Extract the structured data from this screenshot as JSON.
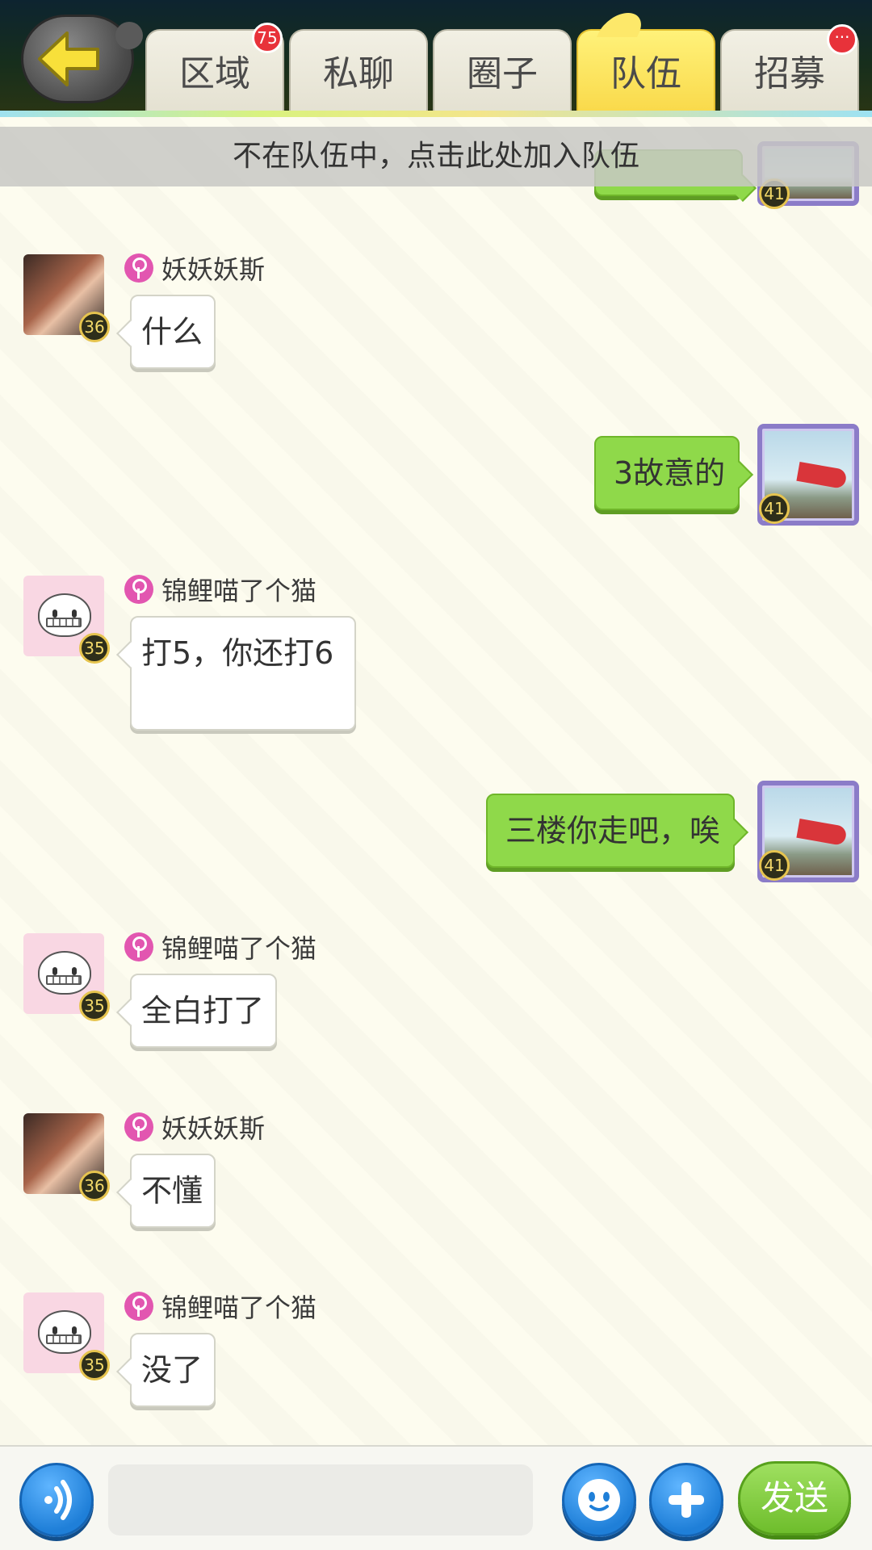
{
  "tabs": [
    {
      "label": "区域",
      "badge": "75"
    },
    {
      "label": "私聊",
      "badge": ""
    },
    {
      "label": "圈子",
      "badge": ""
    },
    {
      "label": "队伍",
      "badge": "",
      "active": true
    },
    {
      "label": "招募",
      "badge": "···"
    }
  ],
  "notice": "不在队伍中，点击此处加入队伍",
  "messages": [
    {
      "sender": "妖妖妖斯",
      "level": "36",
      "text": "什么",
      "self": false
    },
    {
      "sender": "",
      "level": "41",
      "text": "3故意的",
      "self": true
    },
    {
      "sender": "锦鲤喵了个猫",
      "level": "35",
      "text": "打5，你还打6",
      "self": false
    },
    {
      "sender": "",
      "level": "41",
      "text": "三楼你走吧，唉",
      "self": true
    },
    {
      "sender": "锦鲤喵了个猫",
      "level": "35",
      "text": "全白打了",
      "self": false
    },
    {
      "sender": "妖妖妖斯",
      "level": "36",
      "text": "不懂",
      "self": false
    },
    {
      "sender": "锦鲤喵了个猫",
      "level": "35",
      "text": "没了",
      "self": false
    }
  ],
  "top_partial_level": "41",
  "bottom": {
    "send_label": "发送",
    "input_placeholder": ""
  },
  "colors": {
    "active_tab": "#f9d94a",
    "my_bubble": "#8fd94a",
    "badge_red": "#e8323a",
    "female_icon": "#e256b0"
  }
}
